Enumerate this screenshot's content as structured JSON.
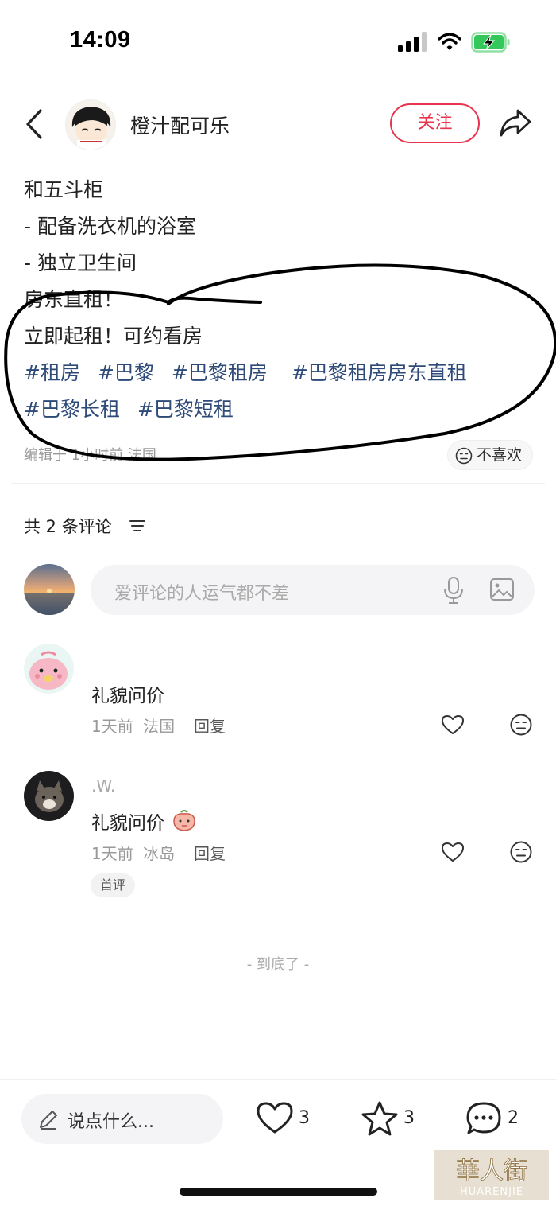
{
  "status_bar": {
    "time": "14:09"
  },
  "nav": {
    "author_name": "橙汁配可乐",
    "follow_label": "关注"
  },
  "post": {
    "lines": [
      "和五斗柜",
      "- 配备洗衣机的浴室",
      "- 独立卫生间",
      "房东直租！",
      "立即起租！可约看房"
    ],
    "tags_row1": [
      "#租房",
      "#巴黎",
      "#巴黎租房",
      "#巴黎租房房东直租"
    ],
    "tags_row2": [
      "#巴黎长租",
      "#巴黎短租"
    ],
    "meta": "编辑于 1小时前 法国",
    "dislike_label": "不喜欢"
  },
  "comments_section": {
    "header": "共 2 条评论",
    "input_placeholder": "爱评论的人运气都不差"
  },
  "comments": [
    {
      "user": "",
      "text": "礼貌问价",
      "time": "1天前",
      "location": "法国",
      "reply_label": "回复"
    },
    {
      "user": ".W.",
      "text": "礼貌问价",
      "time": "1天前",
      "location": "冰岛",
      "reply_label": "回复",
      "badge": "首评"
    }
  ],
  "end_marker": "- 到底了 -",
  "bottom_bar": {
    "input_placeholder": "说点什么...",
    "like_count": "3",
    "collect_count": "3",
    "comment_count": "2"
  },
  "watermark": {
    "text": "華人街",
    "sub": "HUARENJIE"
  },
  "colors": {
    "accent": "#e8344f",
    "tag": "#2e4a78",
    "battery": "#34c759"
  }
}
